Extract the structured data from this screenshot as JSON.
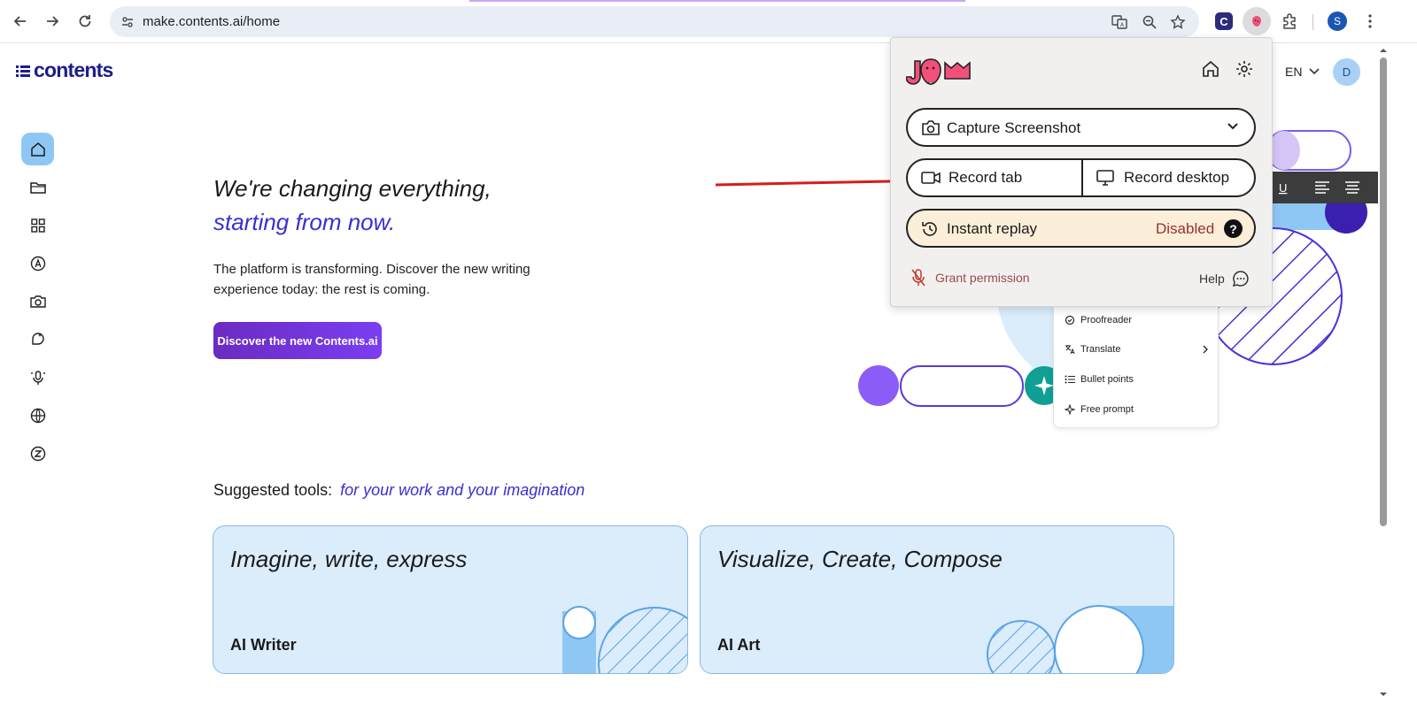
{
  "browser": {
    "url": "make.contents.ai/home",
    "profile_initial": "S",
    "extension_c_label": "C"
  },
  "header": {
    "brand": "contents",
    "language": "EN",
    "user_initial": "D"
  },
  "hero": {
    "title_line1": "We're changing everything,",
    "title_line2": "starting from now.",
    "description": "The platform is transforming. Discover the new writing experience today: the rest is coming.",
    "cta_label": "Discover the new Contents.ai"
  },
  "suggested": {
    "label": "Suggested tools:",
    "accent": "for your work and your imagination"
  },
  "cards": [
    {
      "title": "Imagine, write, express",
      "label": "AI Writer"
    },
    {
      "title": "Visualize, Create, Compose",
      "label": "AI Art"
    }
  ],
  "floating_menu": {
    "items": [
      "Proofreader",
      "Translate",
      "Bullet points",
      "Free prompt"
    ]
  },
  "jam": {
    "capture_label": "Capture Screenshot",
    "record_tab_label": "Record tab",
    "record_desktop_label": "Record desktop",
    "instant_replay_label": "Instant replay",
    "instant_replay_status": "Disabled",
    "grant_permission_label": "Grant permission",
    "help_label": "Help"
  },
  "colors": {
    "accent": "#3a2fd0",
    "cta_start": "#6b2bc1",
    "cta_end": "#7a3ef2",
    "card_bg": "#dbecfb",
    "jam_pink": "#f2507a",
    "disabled_text": "#9b2f2f",
    "annotation_arrow": "#d81b1b"
  }
}
